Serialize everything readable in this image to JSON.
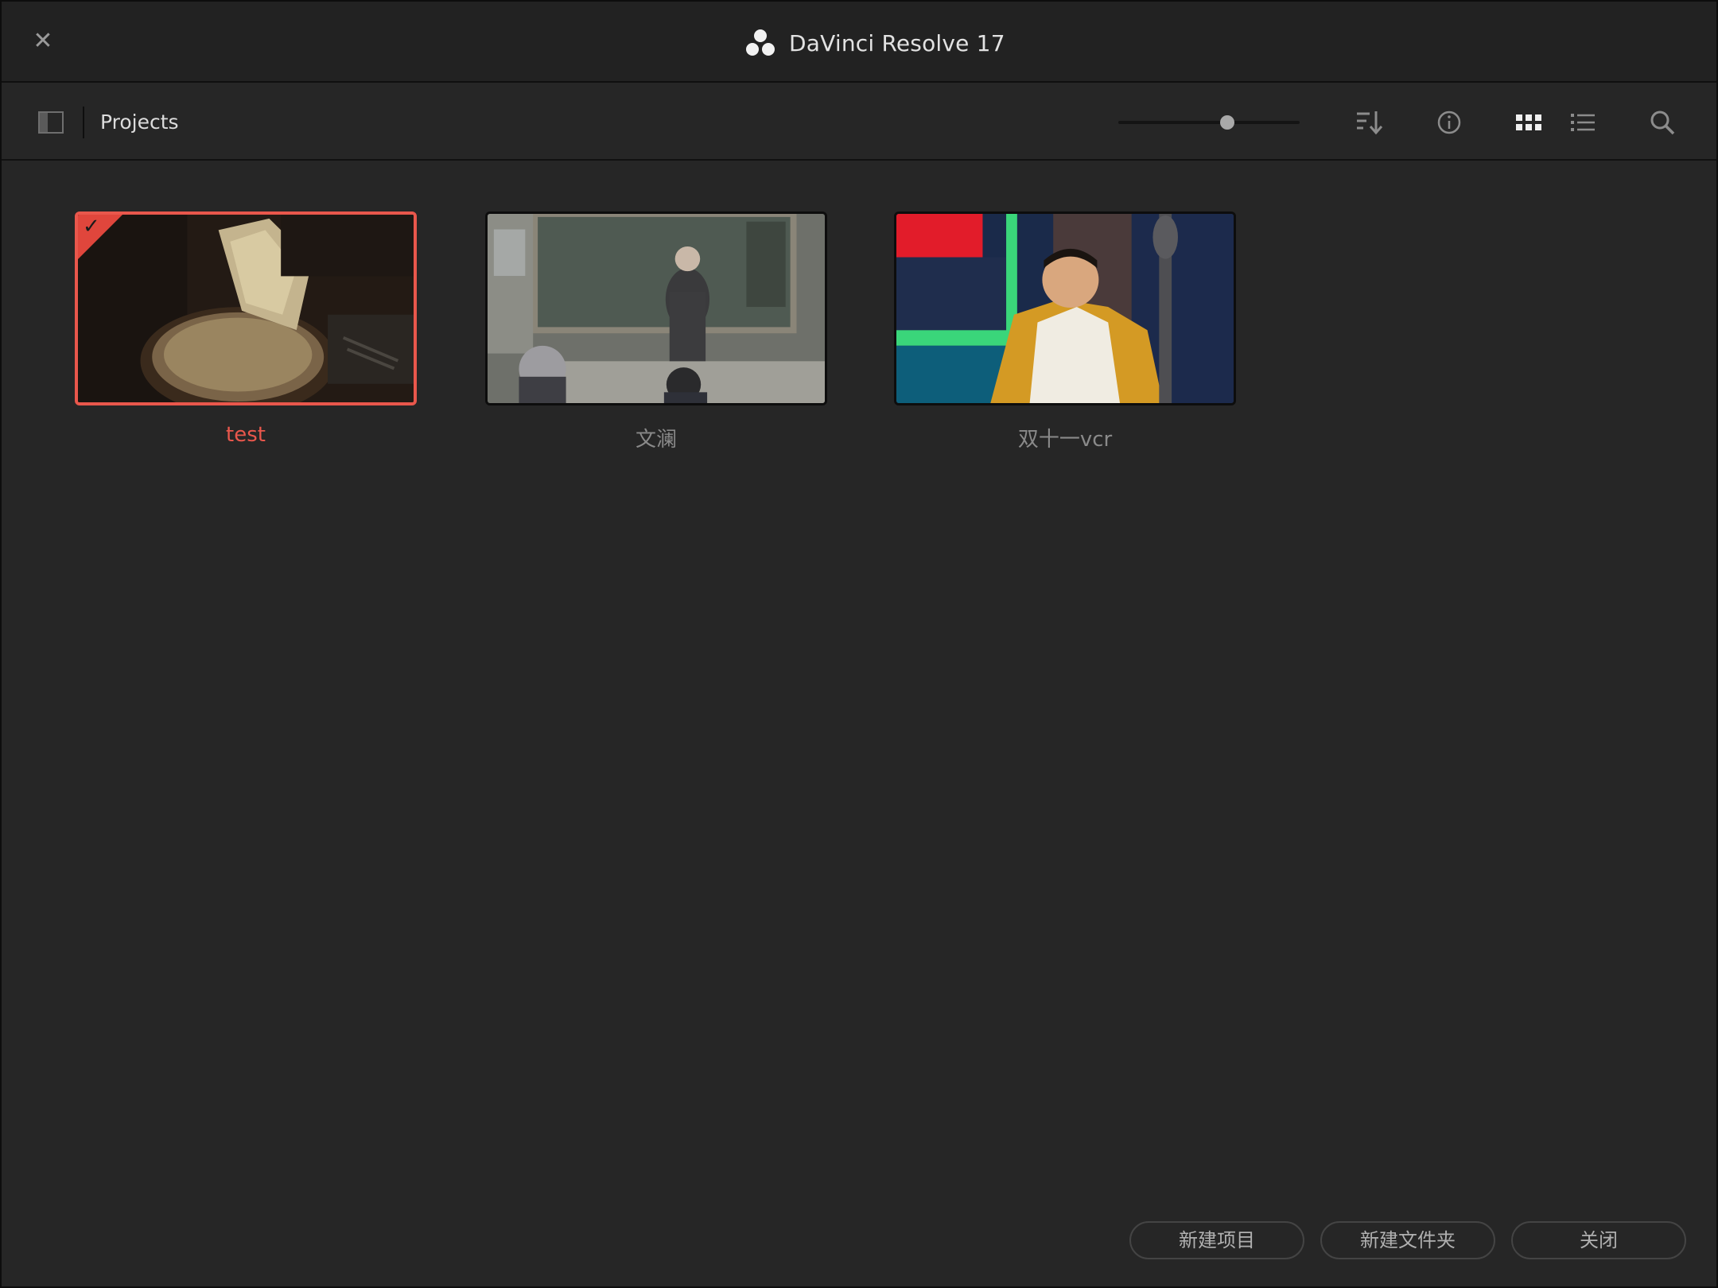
{
  "window": {
    "title": "DaVinci Resolve 17",
    "close_icon": "close-icon",
    "logo_icon": "davinci-logo-icon"
  },
  "toolbar": {
    "breadcrumb": "Projects",
    "zoom_level": 0.6,
    "icons": [
      "sidebar-toggle-icon",
      "sort-icon",
      "info-icon",
      "grid-view-icon",
      "list-view-icon",
      "search-icon"
    ]
  },
  "projects": [
    {
      "name": "test",
      "selected": true
    },
    {
      "name": "文澜",
      "selected": false
    },
    {
      "name": "双十一vcr",
      "selected": false
    }
  ],
  "buttons": {
    "new_project": "新建项目",
    "new_folder": "新建文件夹",
    "close": "关闭"
  },
  "colors": {
    "accent": "#e9574c",
    "background": "#262626"
  }
}
